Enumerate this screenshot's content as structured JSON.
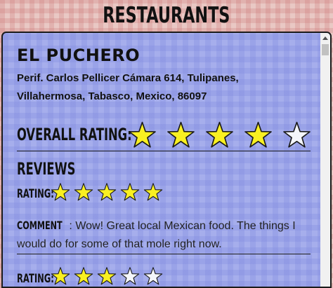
{
  "header": {
    "title": "RESTAURANTS"
  },
  "restaurant": {
    "name": "EL PUCHERO",
    "address_line1": "Perif. Carlos Pellicer Cámara 614, Tulipanes,",
    "address_line2": "Villahermosa, Tabasco, Mexico, 86097",
    "overall_label": "OVERALL RATING:",
    "overall_rating": 4,
    "overall_max": 5
  },
  "reviews": {
    "title": "REVIEWS",
    "items": [
      {
        "rating_label": "RATING:",
        "rating": 5,
        "max": 5,
        "comment_label": "COMMENT",
        "comment": "Wow! Great local Mexican food. The things I would do for some of that mole right now."
      },
      {
        "rating_label": "RATING:",
        "rating": 3,
        "max": 5
      }
    ]
  },
  "colors": {
    "star_filled": "#f9f021",
    "star_empty": "#f4f6fb",
    "star_stroke": "#1a1a1a",
    "card_bg": "#a6aeec"
  }
}
